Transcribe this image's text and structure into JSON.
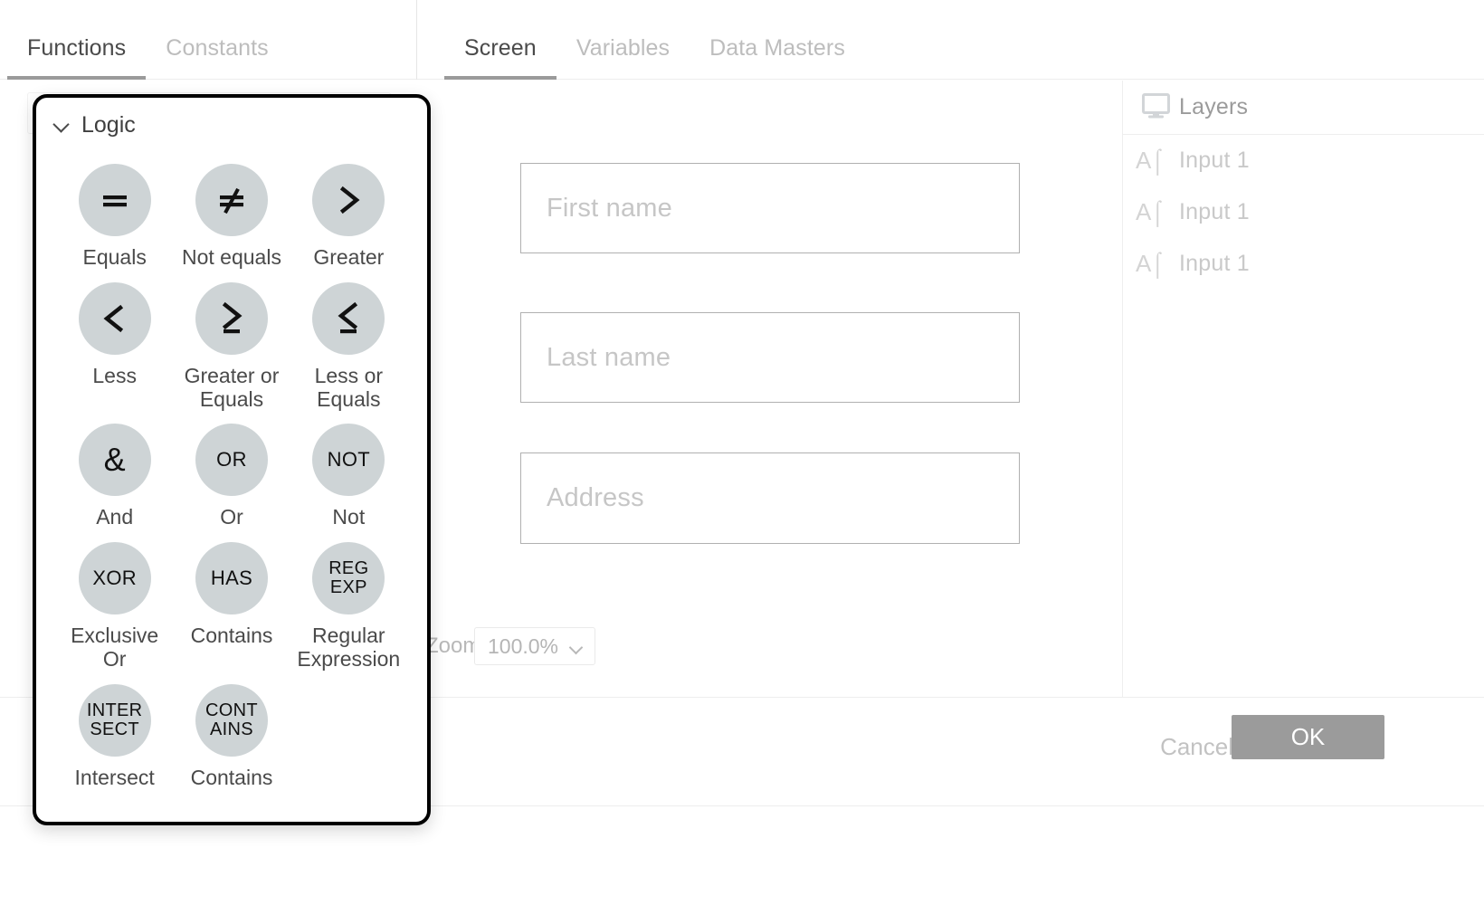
{
  "left_panel": {
    "tabs": [
      {
        "label": "Functions",
        "active": true
      },
      {
        "label": "Constants",
        "active": false
      }
    ]
  },
  "right_panel": {
    "tabs": [
      {
        "label": "Screen",
        "active": true
      },
      {
        "label": "Variables",
        "active": false
      },
      {
        "label": "Data Masters",
        "active": false
      }
    ]
  },
  "canvas": {
    "fields": [
      {
        "placeholder": "First name"
      },
      {
        "placeholder": "Last name"
      },
      {
        "placeholder": "Address"
      }
    ],
    "zoom": {
      "label": "Zoom",
      "value": "100.0%",
      "chevron_icon": "chevron-down-icon"
    }
  },
  "layers": {
    "icon": "monitor-icon",
    "title": "Layers",
    "items": [
      {
        "icon": "text-input-icon",
        "icon_text": "A",
        "label": "Input 1"
      },
      {
        "icon": "text-input-icon",
        "icon_text": "A",
        "label": "Input 1"
      },
      {
        "icon": "text-input-icon",
        "icon_text": "A",
        "label": "Input 1"
      }
    ]
  },
  "footer": {
    "cancel_label": "Cancel",
    "ok_label": "OK"
  },
  "function_picker": {
    "group": {
      "caret_icon": "chevron-down-icon",
      "title": "Logic"
    },
    "functions": [
      {
        "symbol": "=",
        "symbol_type": "glyph",
        "label": "Equals"
      },
      {
        "symbol": "≠",
        "symbol_type": "glyph",
        "label": "Not equals"
      },
      {
        "symbol": ">",
        "symbol_type": "svg-gt",
        "label": "Greater"
      },
      {
        "symbol": "<",
        "symbol_type": "svg-lt",
        "label": "Less"
      },
      {
        "symbol": "≥",
        "symbol_type": "svg-gte",
        "label": "Greater or Equals"
      },
      {
        "symbol": "≤",
        "symbol_type": "svg-lte",
        "label": "Less or Equals"
      },
      {
        "symbol": "&",
        "symbol_type": "glyph",
        "label": "And"
      },
      {
        "symbol": "OR",
        "symbol_type": "word",
        "label": "Or"
      },
      {
        "symbol": "NOT",
        "symbol_type": "word",
        "label": "Not"
      },
      {
        "symbol": "XOR",
        "symbol_type": "word",
        "label": "Exclusive Or"
      },
      {
        "symbol": "HAS",
        "symbol_type": "word",
        "label": "Contains"
      },
      {
        "symbol": "REG\nEXP",
        "symbol_type": "word2",
        "label": "Regular Expression"
      },
      {
        "symbol": "INTER\nSECT",
        "symbol_type": "word2",
        "label": "Intersect"
      },
      {
        "symbol": "CONT\nAINS",
        "symbol_type": "word2",
        "label": "Contains"
      }
    ]
  },
  "colors": {
    "bubble": "#ced4d6",
    "ok_button": "#9b9b9b",
    "active_tab_text": "#4a4a4a",
    "inactive_tab_text": "#bdbdbd",
    "dialog_border": "#000000"
  }
}
